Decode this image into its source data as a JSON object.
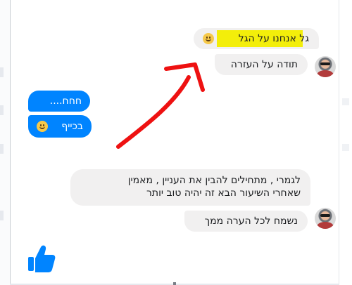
{
  "messages": {
    "m1": {
      "text": "גל אנחנו על הגל",
      "emoji": "slightly-smiling-face-icon"
    },
    "m2": {
      "text": "תודה על העזרה"
    },
    "m3": {
      "text": "חחח...."
    },
    "m4": {
      "text": "בכייף",
      "emoji": "slightly-smiling-face-icon"
    },
    "m5": {
      "line1": "לגמרי , מתחילים להבין את העניין , מאמין",
      "line2": "שאחרי השיעור הבא זה יהיה טוב יותר"
    },
    "m6": {
      "text": "נשמח לכל הערה ממך"
    }
  },
  "colors": {
    "gray_bubble": "#f1f0f0",
    "blue_bubble": "#0084ff",
    "highlight": "#f3ee0a",
    "arrow": "#ee1111"
  },
  "icons": {
    "like": "thumbs-up-icon",
    "avatar": "avatar"
  }
}
